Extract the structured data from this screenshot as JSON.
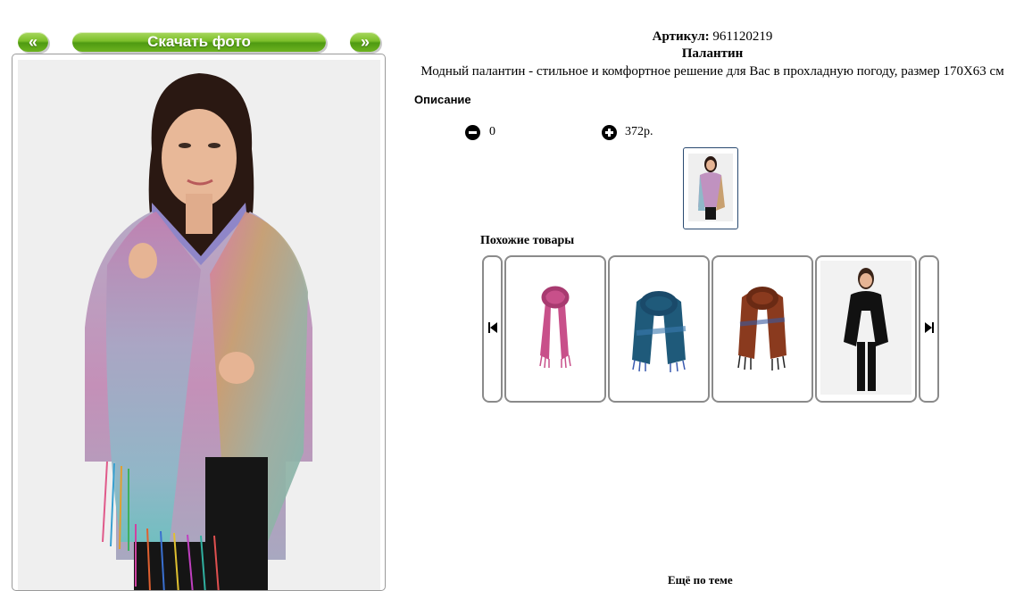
{
  "nav": {
    "prev_label": "«",
    "download_label": "Скачать фото",
    "next_label": "»"
  },
  "product": {
    "article_label": "Артикул:",
    "article_value": "961120219",
    "name": "Палантин",
    "description": "Модный палантин - стильное и комфортное решение для Вас в прохладную погоду, размер 170X63 см",
    "description_heading": "Описание"
  },
  "cart": {
    "quantity": "0",
    "price": "372р."
  },
  "similar": {
    "title": "Похожие товары",
    "items": [
      {
        "color": "#c8508a",
        "icon": "pink-scarf-image"
      },
      {
        "color": "#1f5a7a",
        "icon": "blue-scarf-image"
      },
      {
        "color": "#8a3a1e",
        "icon": "brown-scarf-image"
      },
      {
        "color": "#111111",
        "icon": "black-scarf-model-image"
      }
    ]
  },
  "footer": {
    "more_label": "Ещё по теме"
  },
  "colors": {
    "button_green": "#6db31f",
    "frame_border": "#8a8a8a"
  }
}
